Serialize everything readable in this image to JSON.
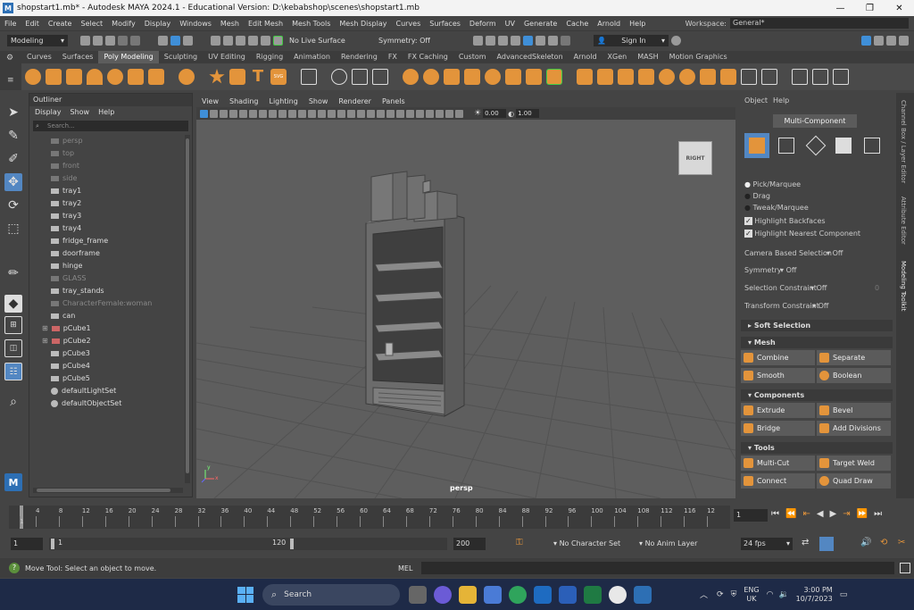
{
  "window": {
    "title": "shopstart1.mb* - Autodesk MAYA 2024.1 - Educational Version: D:\\kebabshop\\scenes\\shopstart1.mb",
    "logo": "M"
  },
  "menubar": {
    "items": [
      "File",
      "Edit",
      "Create",
      "Select",
      "Modify",
      "Display",
      "Windows",
      "Mesh",
      "Edit Mesh",
      "Mesh Tools",
      "Mesh Display",
      "Curves",
      "Surfaces",
      "Deform",
      "UV",
      "Generate",
      "Cache",
      "Arnold",
      "Help"
    ],
    "workspace_label": "Workspace:",
    "workspace_value": "General*"
  },
  "statusline": {
    "mode": "Modeling",
    "live_surface": "No Live Surface",
    "symmetry": "Symmetry: Off",
    "sign_in": "Sign In"
  },
  "shelf": {
    "tabs": [
      "Curves",
      "Surfaces",
      "Poly Modeling",
      "Sculpting",
      "UV Editing",
      "Rigging",
      "Animation",
      "Rendering",
      "FX",
      "FX Caching",
      "Custom",
      "AdvancedSkeleton",
      "Arnold",
      "XGen",
      "MASH",
      "Motion Graphics"
    ],
    "active": "Poly Modeling",
    "text_icon": "T",
    "svg_icon": "SVG"
  },
  "outliner": {
    "title": "Outliner",
    "menus": [
      "Display",
      "Show",
      "Help"
    ],
    "search_placeholder": "Search...",
    "items": [
      {
        "label": "persp",
        "kind": "camera",
        "dim": true
      },
      {
        "label": "top",
        "kind": "camera",
        "dim": true
      },
      {
        "label": "front",
        "kind": "camera",
        "dim": true
      },
      {
        "label": "side",
        "kind": "camera",
        "dim": true
      },
      {
        "label": "tray1",
        "kind": "mesh",
        "dim": false
      },
      {
        "label": "tray2",
        "kind": "mesh",
        "dim": false
      },
      {
        "label": "tray3",
        "kind": "mesh",
        "dim": false
      },
      {
        "label": "tray4",
        "kind": "mesh",
        "dim": false
      },
      {
        "label": "fridge_frame",
        "kind": "mesh",
        "dim": false
      },
      {
        "label": "doorframe",
        "kind": "mesh",
        "dim": false
      },
      {
        "label": "hinge",
        "kind": "mesh",
        "dim": false
      },
      {
        "label": "GLASS",
        "kind": "mesh",
        "dim": true
      },
      {
        "label": "tray_stands",
        "kind": "mesh",
        "dim": false
      },
      {
        "label": "CharacterFemale:woman",
        "kind": "mesh",
        "dim": true
      },
      {
        "label": "can",
        "kind": "mesh",
        "dim": false
      },
      {
        "label": "pCube1",
        "kind": "group",
        "dim": false
      },
      {
        "label": "pCube2",
        "kind": "group",
        "dim": false
      },
      {
        "label": "pCube3",
        "kind": "mesh",
        "dim": false
      },
      {
        "label": "pCube4",
        "kind": "mesh",
        "dim": false
      },
      {
        "label": "pCube5",
        "kind": "mesh",
        "dim": false
      },
      {
        "label": "defaultLightSet",
        "kind": "set",
        "dim": false
      },
      {
        "label": "defaultObjectSet",
        "kind": "set",
        "dim": false
      }
    ]
  },
  "viewport": {
    "menus": [
      "View",
      "Shading",
      "Lighting",
      "Show",
      "Renderer",
      "Panels"
    ],
    "field1": "0.00",
    "field2": "1.00",
    "camera_label": "persp",
    "viewcube": "RIGHT",
    "axis_y": "y",
    "axis_x": "x"
  },
  "toolkit": {
    "menus": [
      "Object",
      "Help"
    ],
    "mode": "Multi-Component",
    "radios": [
      "Pick/Marquee",
      "Drag",
      "Tweak/Marquee"
    ],
    "checks": [
      "Highlight Backfaces",
      "Highlight Nearest Component"
    ],
    "camera_based_label": "Camera Based Selection",
    "camera_based_value": "Off",
    "symmetry_label": "Symmetry",
    "symmetry_value": "Off",
    "sel_constraint_label": "Selection Constraint",
    "sel_constraint_value": "Off",
    "sel_constraint_num": "0",
    "transform_constraint_label": "Transform Constraint",
    "transform_constraint_value": "Off",
    "soft_selection": "Soft Selection",
    "mesh_section": "Mesh",
    "combine": "Combine",
    "separate": "Separate",
    "smooth": "Smooth",
    "boolean": "Boolean",
    "components_section": "Components",
    "extrude": "Extrude",
    "bevel": "Bevel",
    "bridge": "Bridge",
    "add_divisions": "Add Divisions",
    "tools_section": "Tools",
    "multi_cut": "Multi-Cut",
    "target_weld": "Target Weld",
    "connect": "Connect",
    "quad_draw": "Quad Draw"
  },
  "sidetabs": [
    "Channel Box / Layer Editor",
    "Attribute Editor",
    "Modeling Toolkit"
  ],
  "timeline": {
    "ticks": [
      "1",
      "4",
      "8",
      "12",
      "16",
      "20",
      "24",
      "28",
      "32",
      "36",
      "40",
      "44",
      "48",
      "52",
      "56",
      "60",
      "64",
      "68",
      "72",
      "76",
      "80",
      "84",
      "88",
      "92",
      "96",
      "100",
      "104",
      "108",
      "112",
      "116",
      "12"
    ],
    "current_frame": "1",
    "range_start": "1",
    "range_inner_start": "1",
    "range_inner_end": "120",
    "range_end": "200",
    "character_set": "No Character Set",
    "anim_layer": "No Anim Layer",
    "fps": "24 fps"
  },
  "helpline": {
    "message": "Move Tool: Select an object to move.",
    "mel": "MEL"
  },
  "taskbar": {
    "search": "Search",
    "lang1": "ENG",
    "lang2": "UK",
    "time": "3:00 PM",
    "date": "10/7/2023"
  }
}
